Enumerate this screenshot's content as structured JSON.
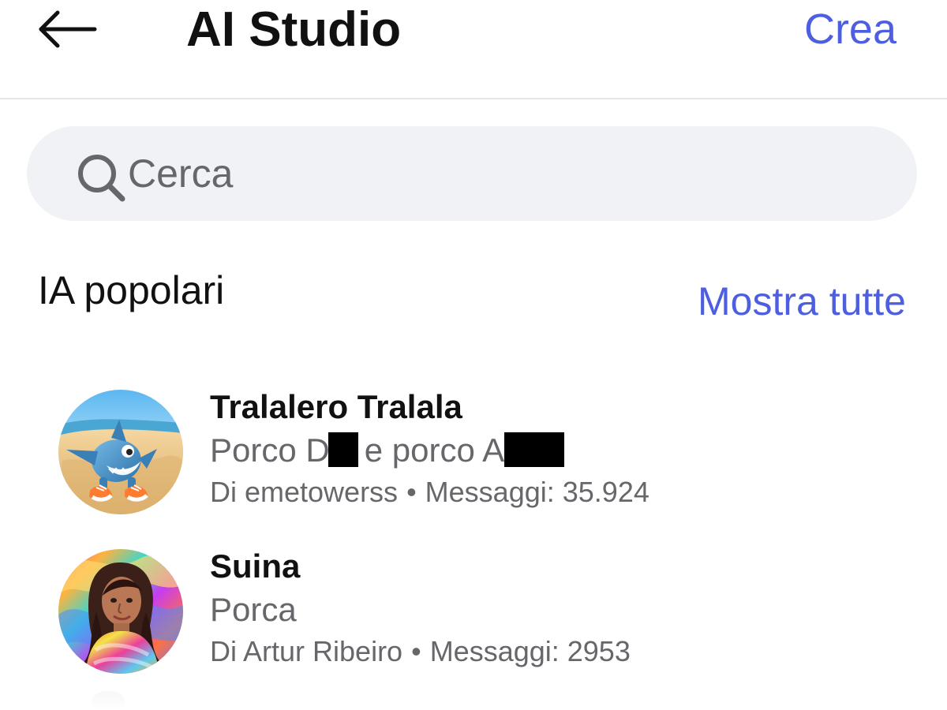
{
  "header": {
    "title": "AI Studio",
    "create_label": "Crea",
    "back_icon": "back-arrow-icon"
  },
  "search": {
    "placeholder": "Cerca",
    "value": "",
    "icon": "search-icon"
  },
  "popular": {
    "title": "IA popolari",
    "show_all_label": "Mostra tutte"
  },
  "ai_items": [
    {
      "name": "Tralalero Tralala",
      "description_before_redaction": "Porco D",
      "description_middle": "e porco A",
      "creator_label": "Di emetowerss",
      "messages_label": "Messaggi: 35.924",
      "avatar_icon": "shark-beach-avatar"
    },
    {
      "name": "Suina",
      "description": "Porca",
      "creator_label": "Di Artur Ribeiro",
      "messages_label": "Messaggi: 2953",
      "avatar_icon": "colorful-portrait-avatar"
    }
  ],
  "meta_separator": "•",
  "colors": {
    "accent": "#4d5fe0",
    "search_background": "#f0f2f5",
    "secondary_text": "#65676b",
    "divider": "#e3e5e8"
  }
}
